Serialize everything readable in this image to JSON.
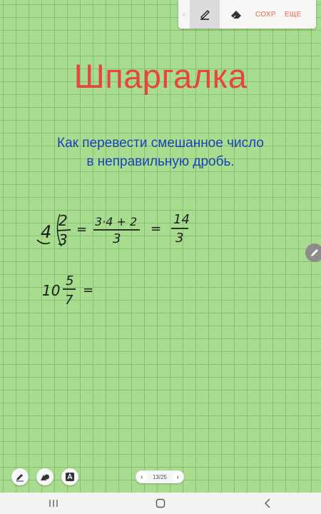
{
  "toolbar": {
    "back_arrow": "‹",
    "pen_icon": "pen-icon",
    "eraser_icon": "eraser-icon",
    "save_label": "СОХР",
    "more_label": "ЕЩЕ",
    "accent_color": "#e8684a"
  },
  "note": {
    "title": "Шпаргалка",
    "title_color": "#e8453c",
    "subtitle_line1": "Как перевести смешанное число",
    "subtitle_line2": "в неправильную дробь.",
    "subtitle_color": "#1a43b8",
    "example1": {
      "whole": "4",
      "numerator": "2",
      "denominator": "3",
      "eq1": "=",
      "expr_numerator": "3·4 + 2",
      "expr_denominator": "3",
      "eq2": "=",
      "result_numerator": "14",
      "result_denominator": "3"
    },
    "example2": {
      "whole": "10",
      "numerator": "5",
      "denominator": "7",
      "eq": "="
    }
  },
  "bottom_tools": [
    "pen-settings-icon",
    "shapes-icon",
    "text-recognition-icon"
  ],
  "pager": {
    "prev": "‹",
    "label": "13/25",
    "next": "›"
  },
  "navbar": [
    "recent-apps-icon",
    "home-icon",
    "back-icon"
  ]
}
